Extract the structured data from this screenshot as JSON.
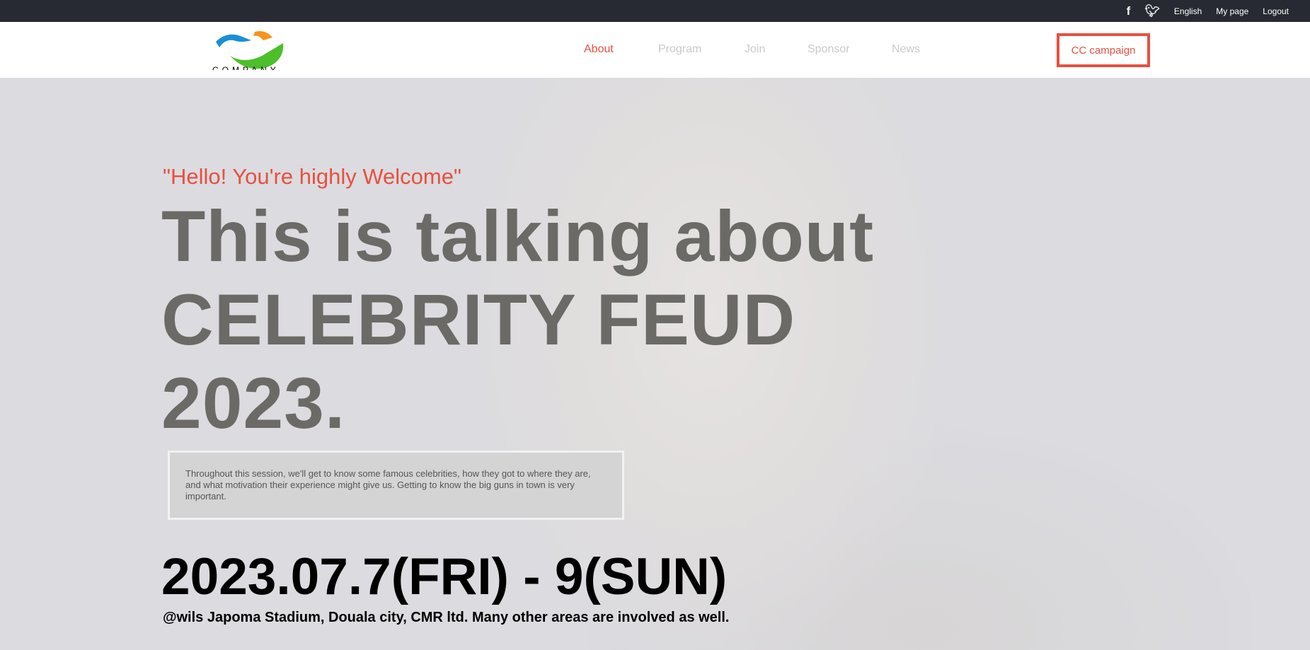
{
  "topbar": {
    "facebook_icon": "facebook-icon",
    "twitter_icon": "twitter-icon",
    "language": "English",
    "mypage": "My page",
    "logout": "Logout"
  },
  "header": {
    "logo_text": "COMPANY",
    "nav": [
      "About",
      "Program",
      "Join",
      "Sponsor",
      "News"
    ],
    "cta": "CC campaign"
  },
  "hero": {
    "quote": "\"Hello! You're highly Welcome\"",
    "headline": [
      "This is talking about",
      "CELEBRITY FEUD",
      "2023."
    ],
    "description": "Throughout this session, we'll get to know some famous celebrities, how they got to where they are, and what motivation their experience might give us. Getting to know the big guns in town is very important.",
    "date": "2023.07.7(FRI) - 9(SUN)",
    "venue": "@wils Japoma Stadium, Douala city, CMR ltd. Many other areas are involved as well."
  },
  "colors": {
    "accent": "#e8503e",
    "topbar": "#272a32"
  }
}
